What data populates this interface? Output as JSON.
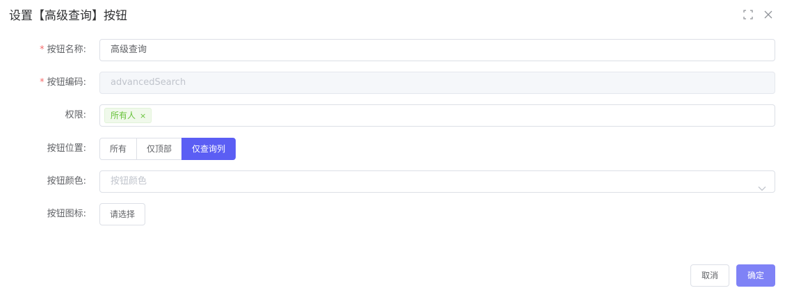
{
  "dialog": {
    "title": "设置【高级查询】按钮"
  },
  "form": {
    "name": {
      "label": "按钮名称:",
      "required_mark": "*",
      "value": "高级查询"
    },
    "code": {
      "label": "按钮编码:",
      "required_mark": "*",
      "placeholder": "advancedSearch"
    },
    "permission": {
      "label": "权限:",
      "tag": "所有人",
      "tag_close": "×"
    },
    "position": {
      "label": "按钮位置:",
      "options": [
        "所有",
        "仅顶部",
        "仅查询列"
      ],
      "selected": "仅查询列"
    },
    "color": {
      "label": "按钮颜色:",
      "placeholder": "按钮颜色"
    },
    "icon": {
      "label": "按钮图标:",
      "button": "请选择"
    }
  },
  "footer": {
    "cancel": "取消",
    "confirm": "确定"
  },
  "colors": {
    "accent": "#5b5ef4",
    "confirm": "#7f82f6",
    "required": "#f56c6c",
    "tag_text": "#67c23a"
  },
  "icons": {
    "fullscreen": "fullscreen-icon",
    "close": "close-icon",
    "select_arrow": "chevron-down-icon"
  }
}
